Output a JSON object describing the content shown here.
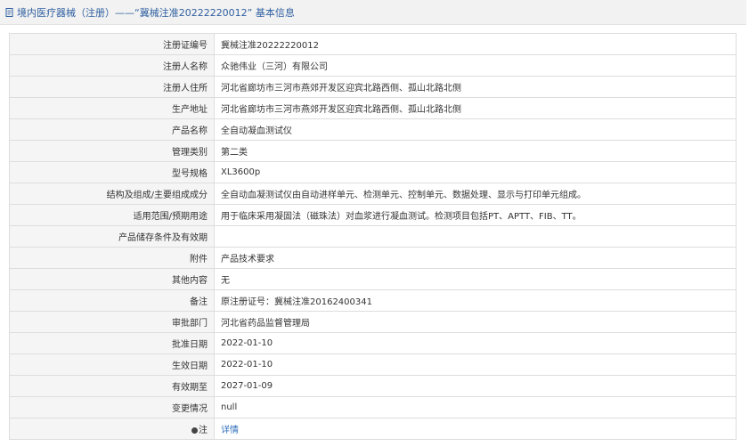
{
  "header": {
    "title": "境内医疗器械（注册）——“冀械注准20222220012” 基本信息",
    "icon": "document-icon"
  },
  "rows": [
    {
      "label": "注册证编号",
      "value": "冀械注准20222220012"
    },
    {
      "label": "注册人名称",
      "value": "众驰伟业（三河）有限公司"
    },
    {
      "label": "注册人住所",
      "value": "河北省廊坊市三河市燕郊开发区迎宾北路西侧、孤山北路北侧"
    },
    {
      "label": "生产地址",
      "value": "河北省廊坊市三河市燕郊开发区迎宾北路西侧、孤山北路北侧"
    },
    {
      "label": "产品名称",
      "value": "全自动凝血测试仪"
    },
    {
      "label": "管理类别",
      "value": "第二类"
    },
    {
      "label": "型号规格",
      "value": "XL3600p"
    },
    {
      "label": "结构及组成/主要组成成分",
      "value": "全自动血凝测试仪由自动进样单元、检测单元、控制单元、数据处理、显示与打印单元组成。"
    },
    {
      "label": "适用范围/预期用途",
      "value": "用于临床采用凝固法（磁珠法）对血浆进行凝血测试。检测项目包括PT、APTT、FIB、TT。"
    },
    {
      "label": "产品储存条件及有效期",
      "value": ""
    },
    {
      "label": "附件",
      "value": "产品技术要求"
    },
    {
      "label": "其他内容",
      "value": "无"
    },
    {
      "label": "备注",
      "value": "原注册证号：冀械注准20162400341"
    },
    {
      "label": "审批部门",
      "value": "河北省药品监督管理局"
    },
    {
      "label": "批准日期",
      "value": "2022-01-10"
    },
    {
      "label": "生效日期",
      "value": "2022-01-10"
    },
    {
      "label": "有效期至",
      "value": "2027-01-09"
    },
    {
      "label": "变更情况",
      "value": "null"
    }
  ],
  "note_row": {
    "label": "注",
    "link_text": "详情",
    "icon": "note-icon"
  }
}
